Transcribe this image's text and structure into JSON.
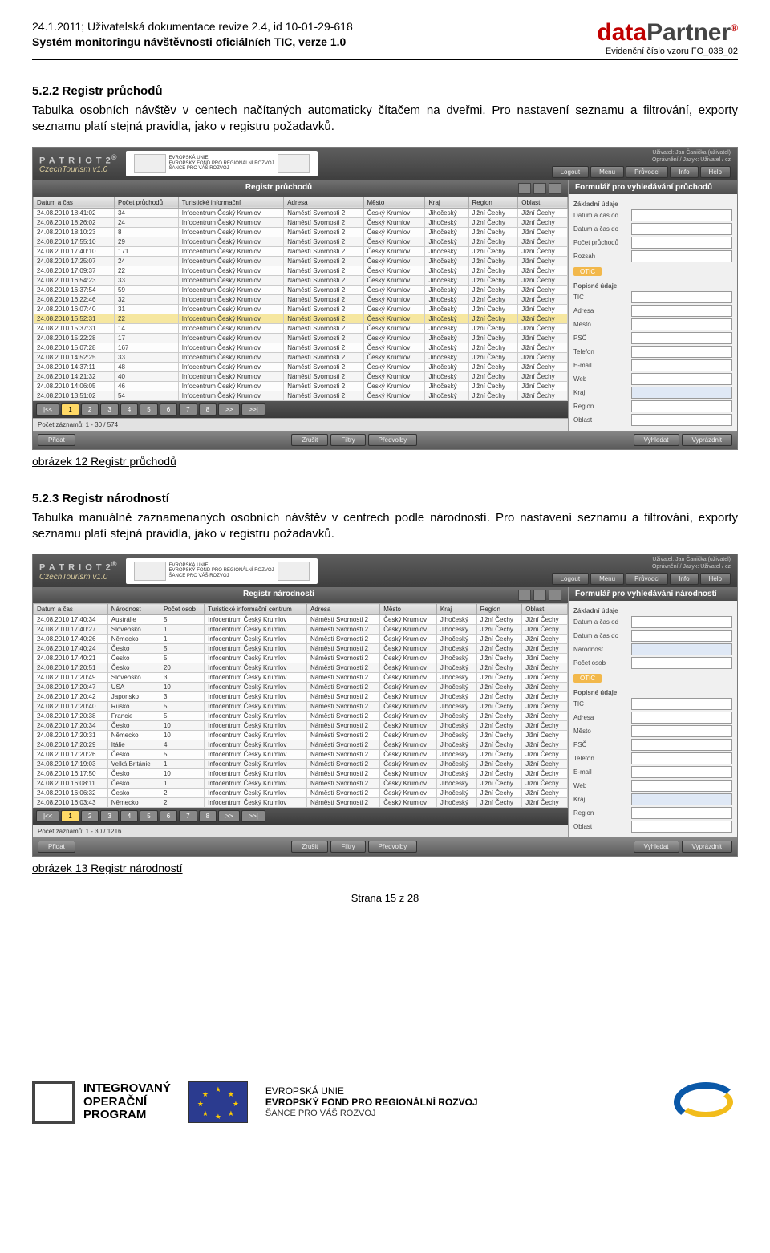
{
  "header": {
    "line1": "24.1.2011; Uživatelská dokumentace revize 2.4, id 10-01-29-618",
    "line2": "Systém monitoringu návštěvnosti oficiálních TIC, verze 1.0",
    "brand1": "data",
    "brand2": "Partner",
    "sub": "Evidenční číslo vzoru FO_038_02"
  },
  "section522": {
    "title": "5.2.2  Registr průchodů",
    "para": "Tabulka osobních návštěv v centech načítaných automaticky čítačem na dveřmi. Pro nastavení seznamu a filtrování, exporty seznamu  platí stejná pravidla, jako v registru požadavků.",
    "caption": "obrázek 12 Registr průchodů"
  },
  "section523": {
    "title": "5.2.3  Registr národností",
    "para": "Tabulka manuálně zaznamenaných osobních návštěv v centrech podle národností. Pro nastavení seznamu a filtrování, exporty seznamu  platí stejná pravidla, jako v registru požadavků.",
    "caption": "obrázek 13 Registr národností"
  },
  "page_number": "Strana 15 z 28",
  "app_common": {
    "patriot": "P A T R I O T 2",
    "czech": "CzechTourism  v1.0",
    "eu_text": "EVROPSKÁ UNIE\nEVROPSKÝ FOND PRO REGIONÁLNÍ ROZVOJ\nŠANCE PRO VÁŠ ROZVOJ",
    "user": "Uživatel: Jan Čanička (uživatel)",
    "perm": "Oprávnění / Jazyk: Uživatel / cz",
    "top_buttons": [
      "Logout",
      "Menu",
      "Průvodci",
      "Info",
      "Help"
    ],
    "pager": [
      "|<<",
      "1",
      "2",
      "3",
      "4",
      "5",
      "6",
      "7",
      "8",
      ">>",
      ">>|"
    ],
    "bottom": {
      "left": "Přidat",
      "mid": [
        "Zrušit",
        "Filtry",
        "Předvolby"
      ],
      "right": [
        "Vyhledat",
        "Vyprázdnit"
      ]
    }
  },
  "app1": {
    "title": "Registr průchodů",
    "side_title": "Formulář pro vyhledávání průchodů",
    "recount": "Počet záznamů: 1 - 30 / 574",
    "cols": [
      "Datum a čas",
      "Počet průchodů",
      "Turistické informační",
      "Adresa",
      "Město",
      "Kraj",
      "Region",
      "Oblast"
    ],
    "rows": [
      [
        "24.08.2010 18:41:02",
        "34",
        "Infocentrum Český Krumlov",
        "Náměstí Svornosti 2",
        "Český Krumlov",
        "Jihočeský",
        "Jižní Čechy",
        "Jižní Čechy"
      ],
      [
        "24.08.2010 18:26:02",
        "24",
        "Infocentrum Český Krumlov",
        "Náměstí Svornosti 2",
        "Český Krumlov",
        "Jihočeský",
        "Jižní Čechy",
        "Jižní Čechy"
      ],
      [
        "24.08.2010 18:10:23",
        "8",
        "Infocentrum Český Krumlov",
        "Náměstí Svornosti 2",
        "Český Krumlov",
        "Jihočeský",
        "Jižní Čechy",
        "Jižní Čechy"
      ],
      [
        "24.08.2010 17:55:10",
        "29",
        "Infocentrum Český Krumlov",
        "Náměstí Svornosti 2",
        "Český Krumlov",
        "Jihočeský",
        "Jižní Čechy",
        "Jižní Čechy"
      ],
      [
        "24.08.2010 17:40:10",
        "171",
        "Infocentrum Český Krumlov",
        "Náměstí Svornosti 2",
        "Český Krumlov",
        "Jihočeský",
        "Jižní Čechy",
        "Jižní Čechy"
      ],
      [
        "24.08.2010 17:25:07",
        "24",
        "Infocentrum Český Krumlov",
        "Náměstí Svornosti 2",
        "Český Krumlov",
        "Jihočeský",
        "Jižní Čechy",
        "Jižní Čechy"
      ],
      [
        "24.08.2010 17:09:37",
        "22",
        "Infocentrum Český Krumlov",
        "Náměstí Svornosti 2",
        "Český Krumlov",
        "Jihočeský",
        "Jižní Čechy",
        "Jižní Čechy"
      ],
      [
        "24.08.2010 16:54:23",
        "33",
        "Infocentrum Český Krumlov",
        "Náměstí Svornosti 2",
        "Český Krumlov",
        "Jihočeský",
        "Jižní Čechy",
        "Jižní Čechy"
      ],
      [
        "24.08.2010 16:37:54",
        "59",
        "Infocentrum Český Krumlov",
        "Náměstí Svornosti 2",
        "Český Krumlov",
        "Jihočeský",
        "Jižní Čechy",
        "Jižní Čechy"
      ],
      [
        "24.08.2010 16:22:46",
        "32",
        "Infocentrum Český Krumlov",
        "Náměstí Svornosti 2",
        "Český Krumlov",
        "Jihočeský",
        "Jižní Čechy",
        "Jižní Čechy"
      ],
      [
        "24.08.2010 16:07:40",
        "31",
        "Infocentrum Český Krumlov",
        "Náměstí Svornosti 2",
        "Český Krumlov",
        "Jihočeský",
        "Jižní Čechy",
        "Jižní Čechy"
      ],
      [
        "24.08.2010 15:52:31",
        "22",
        "Infocentrum Český Krumlov",
        "Náměstí Svornosti 2",
        "Český Krumlov",
        "Jihočeský",
        "Jižní Čechy",
        "Jižní Čechy"
      ],
      [
        "24.08.2010 15:37:31",
        "14",
        "Infocentrum Český Krumlov",
        "Náměstí Svornosti 2",
        "Český Krumlov",
        "Jihočeský",
        "Jižní Čechy",
        "Jižní Čechy"
      ],
      [
        "24.08.2010 15:22:28",
        "17",
        "Infocentrum Český Krumlov",
        "Náměstí Svornosti 2",
        "Český Krumlov",
        "Jihočeský",
        "Jižní Čechy",
        "Jižní Čechy"
      ],
      [
        "24.08.2010 15:07:28",
        "167",
        "Infocentrum Český Krumlov",
        "Náměstí Svornosti 2",
        "Český Krumlov",
        "Jihočeský",
        "Jižní Čechy",
        "Jižní Čechy"
      ],
      [
        "24.08.2010 14:52:25",
        "33",
        "Infocentrum Český Krumlov",
        "Náměstí Svornosti 2",
        "Český Krumlov",
        "Jihočeský",
        "Jižní Čechy",
        "Jižní Čechy"
      ],
      [
        "24.08.2010 14:37:11",
        "48",
        "Infocentrum Český Krumlov",
        "Náměstí Svornosti 2",
        "Český Krumlov",
        "Jihočeský",
        "Jižní Čechy",
        "Jižní Čechy"
      ],
      [
        "24.08.2010 14:21:32",
        "40",
        "Infocentrum Český Krumlov",
        "Náměstí Svornosti 2",
        "Český Krumlov",
        "Jihočeský",
        "Jižní Čechy",
        "Jižní Čechy"
      ],
      [
        "24.08.2010 14:06:05",
        "46",
        "Infocentrum Český Krumlov",
        "Náměstí Svornosti 2",
        "Český Krumlov",
        "Jihočeský",
        "Jižní Čechy",
        "Jižní Čechy"
      ],
      [
        "24.08.2010 13:51:02",
        "54",
        "Infocentrum Český Krumlov",
        "Náměstí Svornosti 2",
        "Český Krumlov",
        "Jihočeský",
        "Jižní Čechy",
        "Jižní Čechy"
      ]
    ],
    "hl_row": 11,
    "form": {
      "group1": "Základní údaje",
      "fields1": [
        {
          "label": "Datum a čas od"
        },
        {
          "label": "Datum a čas do"
        },
        {
          "label": "Počet průchodů"
        },
        {
          "label": "Rozsah"
        }
      ],
      "tab": "OTIC",
      "group2": "Popisné údaje",
      "fields2": [
        {
          "label": "TIC"
        },
        {
          "label": "Adresa"
        },
        {
          "label": "Město"
        },
        {
          "label": "PSČ"
        },
        {
          "label": "Telefon"
        },
        {
          "label": "E-mail"
        },
        {
          "label": "Web"
        },
        {
          "label": "Kraj",
          "select": true
        },
        {
          "label": "Region"
        },
        {
          "label": "Oblast"
        }
      ]
    }
  },
  "app2": {
    "title": "Registr národností",
    "side_title": "Formulář pro vyhledávání národností",
    "recount": "Počet záznamů: 1 - 30 / 1216",
    "cols": [
      "Datum a čas",
      "Národnost",
      "Počet osob",
      "Turistické informační centrum",
      "Adresa",
      "Město",
      "Kraj",
      "Region",
      "Oblast"
    ],
    "rows": [
      [
        "24.08.2010 17:40:34",
        "Austrálie",
        "5",
        "Infocentrum Český Krumlov",
        "Náměstí Svornosti 2",
        "Český Krumlov",
        "Jihočeský",
        "Jižní Čechy",
        "Jižní Čechy"
      ],
      [
        "24.08.2010 17:40:27",
        "Slovensko",
        "1",
        "Infocentrum Český Krumlov",
        "Náměstí Svornosti 2",
        "Český Krumlov",
        "Jihočeský",
        "Jižní Čechy",
        "Jižní Čechy"
      ],
      [
        "24.08.2010 17:40:26",
        "Německo",
        "1",
        "Infocentrum Český Krumlov",
        "Náměstí Svornosti 2",
        "Český Krumlov",
        "Jihočeský",
        "Jižní Čechy",
        "Jižní Čechy"
      ],
      [
        "24.08.2010 17:40:24",
        "Česko",
        "5",
        "Infocentrum Český Krumlov",
        "Náměstí Svornosti 2",
        "Český Krumlov",
        "Jihočeský",
        "Jižní Čechy",
        "Jižní Čechy"
      ],
      [
        "24.08.2010 17:40:21",
        "Česko",
        "5",
        "Infocentrum Český Krumlov",
        "Náměstí Svornosti 2",
        "Český Krumlov",
        "Jihočeský",
        "Jižní Čechy",
        "Jižní Čechy"
      ],
      [
        "24.08.2010 17:20:51",
        "Česko",
        "20",
        "Infocentrum Český Krumlov",
        "Náměstí Svornosti 2",
        "Český Krumlov",
        "Jihočeský",
        "Jižní Čechy",
        "Jižní Čechy"
      ],
      [
        "24.08.2010 17:20:49",
        "Slovensko",
        "3",
        "Infocentrum Český Krumlov",
        "Náměstí Svornosti 2",
        "Český Krumlov",
        "Jihočeský",
        "Jižní Čechy",
        "Jižní Čechy"
      ],
      [
        "24.08.2010 17:20:47",
        "USA",
        "10",
        "Infocentrum Český Krumlov",
        "Náměstí Svornosti 2",
        "Český Krumlov",
        "Jihočeský",
        "Jižní Čechy",
        "Jižní Čechy"
      ],
      [
        "24.08.2010 17:20:42",
        "Japonsko",
        "3",
        "Infocentrum Český Krumlov",
        "Náměstí Svornosti 2",
        "Český Krumlov",
        "Jihočeský",
        "Jižní Čechy",
        "Jižní Čechy"
      ],
      [
        "24.08.2010 17:20:40",
        "Rusko",
        "5",
        "Infocentrum Český Krumlov",
        "Náměstí Svornosti 2",
        "Český Krumlov",
        "Jihočeský",
        "Jižní Čechy",
        "Jižní Čechy"
      ],
      [
        "24.08.2010 17:20:38",
        "Francie",
        "5",
        "Infocentrum Český Krumlov",
        "Náměstí Svornosti 2",
        "Český Krumlov",
        "Jihočeský",
        "Jižní Čechy",
        "Jižní Čechy"
      ],
      [
        "24.08.2010 17:20:34",
        "Česko",
        "10",
        "Infocentrum Český Krumlov",
        "Náměstí Svornosti 2",
        "Český Krumlov",
        "Jihočeský",
        "Jižní Čechy",
        "Jižní Čechy"
      ],
      [
        "24.08.2010 17:20:31",
        "Německo",
        "10",
        "Infocentrum Český Krumlov",
        "Náměstí Svornosti 2",
        "Český Krumlov",
        "Jihočeský",
        "Jižní Čechy",
        "Jižní Čechy"
      ],
      [
        "24.08.2010 17:20:29",
        "Itálie",
        "4",
        "Infocentrum Český Krumlov",
        "Náměstí Svornosti 2",
        "Český Krumlov",
        "Jihočeský",
        "Jižní Čechy",
        "Jižní Čechy"
      ],
      [
        "24.08.2010 17:20:26",
        "Česko",
        "5",
        "Infocentrum Český Krumlov",
        "Náměstí Svornosti 2",
        "Český Krumlov",
        "Jihočeský",
        "Jižní Čechy",
        "Jižní Čechy"
      ],
      [
        "24.08.2010 17:19:03",
        "Velká Británie",
        "1",
        "Infocentrum Český Krumlov",
        "Náměstí Svornosti 2",
        "Český Krumlov",
        "Jihočeský",
        "Jižní Čechy",
        "Jižní Čechy"
      ],
      [
        "24.08.2010 16:17:50",
        "Česko",
        "10",
        "Infocentrum Český Krumlov",
        "Náměstí Svornosti 2",
        "Český Krumlov",
        "Jihočeský",
        "Jižní Čechy",
        "Jižní Čechy"
      ],
      [
        "24.08.2010 16:08:11",
        "Česko",
        "1",
        "Infocentrum Český Krumlov",
        "Náměstí Svornosti 2",
        "Český Krumlov",
        "Jihočeský",
        "Jižní Čechy",
        "Jižní Čechy"
      ],
      [
        "24.08.2010 16:06:32",
        "Česko",
        "2",
        "Infocentrum Český Krumlov",
        "Náměstí Svornosti 2",
        "Český Krumlov",
        "Jihočeský",
        "Jižní Čechy",
        "Jižní Čechy"
      ],
      [
        "24.08.2010 16:03:43",
        "Německo",
        "2",
        "Infocentrum Český Krumlov",
        "Náměstí Svornosti 2",
        "Český Krumlov",
        "Jihočeský",
        "Jižní Čechy",
        "Jižní Čechy"
      ]
    ],
    "form": {
      "group1": "Základní údaje",
      "fields1": [
        {
          "label": "Datum a čas od"
        },
        {
          "label": "Datum a čas do"
        },
        {
          "label": "Národnost",
          "select": true
        },
        {
          "label": "Počet osob"
        }
      ],
      "tab": "OTIC",
      "group2": "Popisné údaje",
      "fields2": [
        {
          "label": "TIC"
        },
        {
          "label": "Adresa"
        },
        {
          "label": "Město"
        },
        {
          "label": "PSČ"
        },
        {
          "label": "Telefon"
        },
        {
          "label": "E-mail"
        },
        {
          "label": "Web"
        },
        {
          "label": "Kraj",
          "select": true
        },
        {
          "label": "Region"
        },
        {
          "label": "Oblast"
        }
      ]
    }
  },
  "footer": {
    "iop": "INTEGROVANÝ\nOPERAČNÍ\nPROGRAM",
    "eu1": "EVROPSKÁ UNIE",
    "eu2": "EVROPSKÝ FOND PRO REGIONÁLNÍ ROZVOJ",
    "eu3": "ŠANCE PRO VÁŠ ROZVOJ"
  }
}
